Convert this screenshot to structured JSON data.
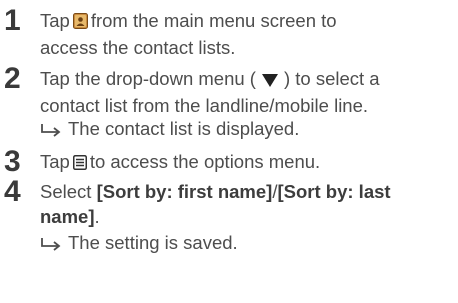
{
  "steps": [
    {
      "number": "1",
      "line1_before": "Tap",
      "line1_after": "from the main menu screen to",
      "line2": "access the contact lists.",
      "icon": "contacts-app-icon"
    },
    {
      "number": "2",
      "line1_before": "Tap the drop-down menu (",
      "line1_after": ") to select a",
      "line2": "contact list from the landline/mobile line.",
      "result": "The contact list is displayed.",
      "icon": "triangle-down-icon"
    },
    {
      "number": "3",
      "line1_before": "Tap",
      "line1_after": "to access the options menu.",
      "icon": "options-menu-icon"
    },
    {
      "number": "4",
      "line1_before": "Select",
      "option_first": "[Sort by: first name]",
      "separator": "/",
      "option_last_line1": "[Sort by: last",
      "option_last_line2": "name]",
      "line2_after": ".",
      "result": "The setting is saved."
    }
  ],
  "colors": {
    "text": "#4d4d4d",
    "number": "#3a3a3a",
    "icon_brown": "#b5651d"
  }
}
